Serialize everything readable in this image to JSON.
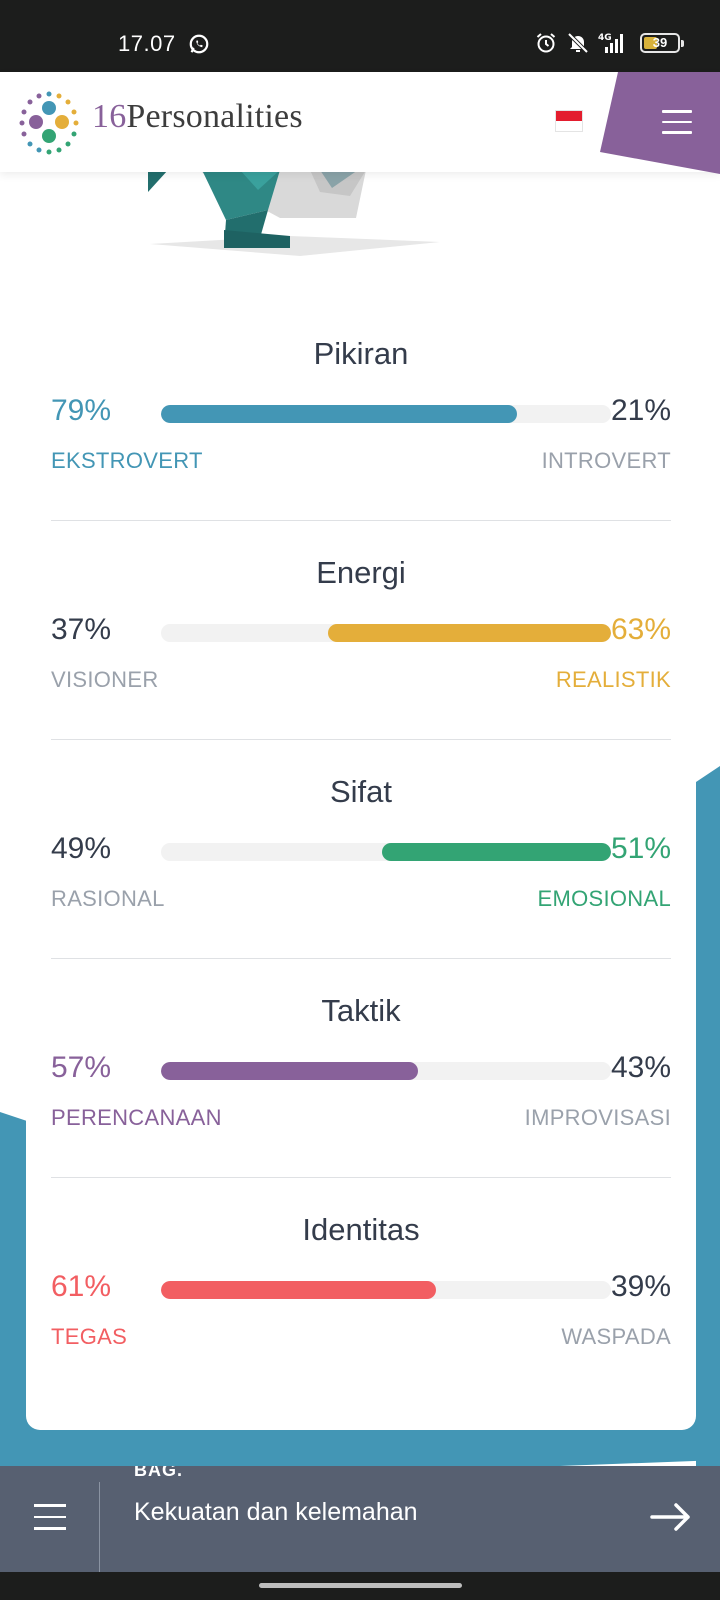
{
  "status_bar": {
    "time": "17.07",
    "battery_level": "39"
  },
  "header": {
    "logo_number": "16",
    "logo_name": "Personalities",
    "language_flag": "indonesia-flag"
  },
  "colors": {
    "teal": "#4396b5",
    "yellow": "#e4ae3a",
    "green": "#33a474",
    "purple": "#88619a",
    "red": "#f25e62",
    "dark_text": "#343c4b",
    "muted_text": "#9aa1ab",
    "bottom_nav": "#576071"
  },
  "traits": [
    {
      "title": "Pikiran",
      "left_pct": "79%",
      "right_pct": "21%",
      "left_label": "EKSTROVERT",
      "right_label": "INTROVERT",
      "fill_side": "left",
      "fill_fraction": 0.79,
      "color": "#4396b5"
    },
    {
      "title": "Energi",
      "left_pct": "37%",
      "right_pct": "63%",
      "left_label": "VISIONER",
      "right_label": "REALISTIK",
      "fill_side": "right",
      "fill_fraction": 0.63,
      "color": "#e4ae3a"
    },
    {
      "title": "Sifat",
      "left_pct": "49%",
      "right_pct": "51%",
      "left_label": "RASIONAL",
      "right_label": "EMOSIONAL",
      "fill_side": "right",
      "fill_fraction": 0.51,
      "color": "#33a474"
    },
    {
      "title": "Taktik",
      "left_pct": "57%",
      "right_pct": "43%",
      "left_label": "PERENCANAAN",
      "right_label": "IMPROVISASI",
      "fill_side": "left",
      "fill_fraction": 0.57,
      "color": "#88619a"
    },
    {
      "title": "Identitas",
      "left_pct": "61%",
      "right_pct": "39%",
      "left_label": "TEGAS",
      "right_label": "WASPADA",
      "fill_side": "left",
      "fill_fraction": 0.61,
      "color": "#f25e62"
    }
  ],
  "bottom_nav": {
    "overline": "BAG.",
    "title": "Kekuatan dan kelemahan"
  }
}
